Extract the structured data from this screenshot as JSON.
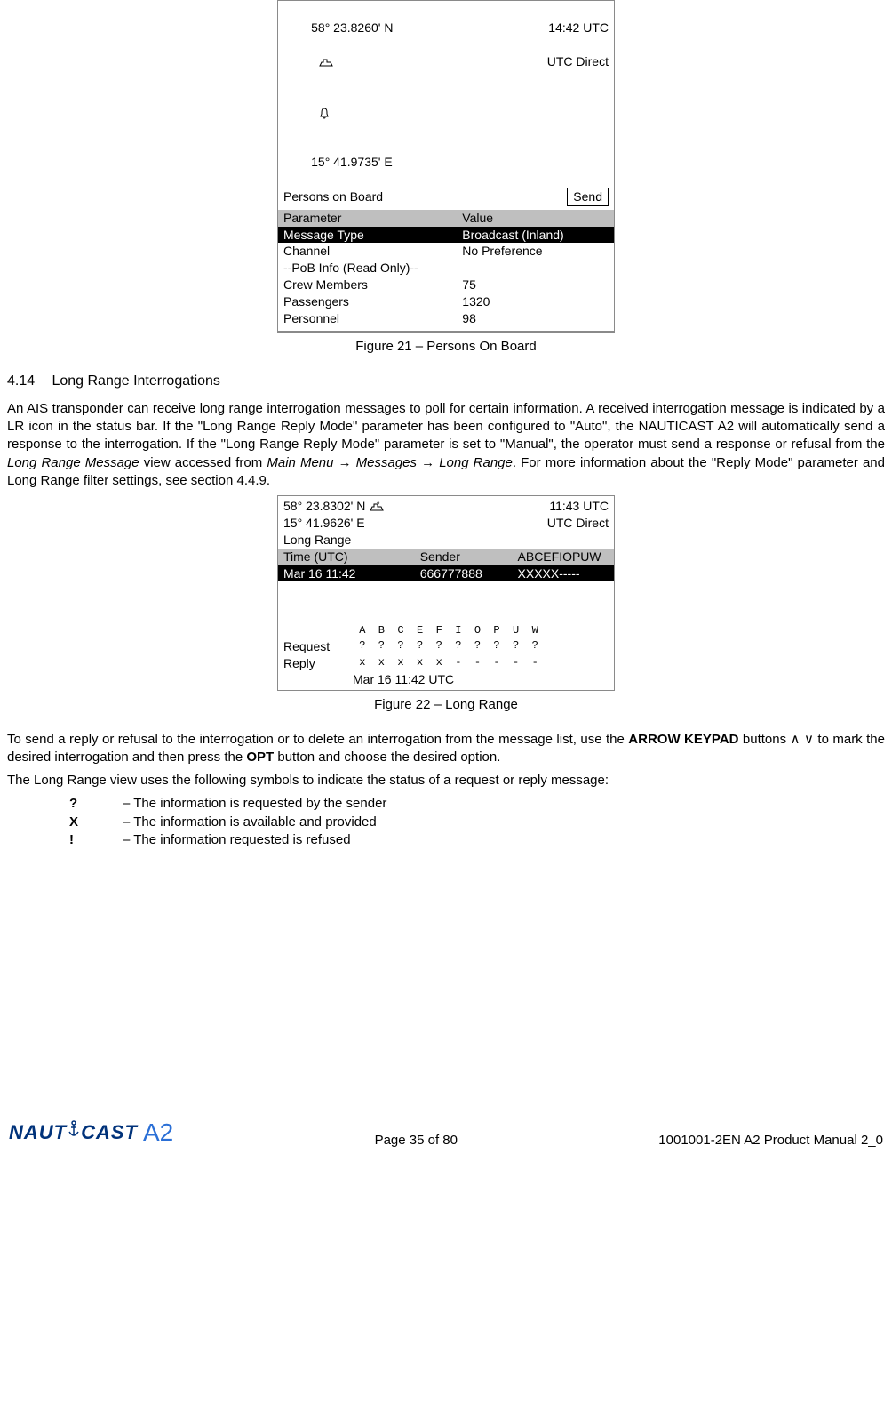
{
  "fig21": {
    "status": {
      "lat": "58° 23.8260' N",
      "lon": "15° 41.9735' E",
      "time": "14:42 UTC",
      "mode": "UTC Direct"
    },
    "title": "Persons on Board",
    "send_btn": "Send",
    "header": {
      "c1": "Parameter",
      "c2": "Value"
    },
    "highlight": {
      "c1": "Message Type",
      "c2": "Broadcast (Inland)"
    },
    "rows": [
      {
        "c1": "Channel",
        "c2": "No Preference"
      },
      {
        "c1": "--PoB Info (Read Only)--",
        "c2": ""
      },
      {
        "c1": "Crew Members",
        "c2": "75"
      },
      {
        "c1": "Passengers",
        "c2": "1320"
      },
      {
        "c1": "Personnel",
        "c2": "98"
      }
    ],
    "caption": "Figure 21 – Persons On Board"
  },
  "section": {
    "num": "4.14",
    "title": "Long Range Interrogations"
  },
  "para1_a": "An AIS transponder can receive long range interrogation messages to poll for certain information. A received interrogation message is indicated by a LR icon in the status bar. If the \"Long Range Reply Mode\" parameter has been configured to \"Auto\", the NAUTICAST A2 will automatically send a response to the interrogation. If the \"Long Range Reply Mode\" parameter is set to \"Manual\", the operator must send a response or refusal from the ",
  "para1_i1": "Long Range Message",
  "para1_b": " view accessed from ",
  "para1_i2": "Main Menu → Messages → Long Range",
  "para1_c": ". For more information about the \"Reply Mode\" parameter and Long Range filter settings, see section 4.4.9.",
  "fig22": {
    "status": {
      "lat": "58° 23.8302' N",
      "lon": "15° 41.9626' E",
      "time": "11:43 UTC",
      "mode": "UTC Direct"
    },
    "title": "Long Range",
    "header": {
      "c1": "Time (UTC)",
      "c2": "Sender",
      "c3": "ABCEFIOPUW"
    },
    "highlight": {
      "c1": "Mar 16 11:42",
      "c2": "666777888",
      "c3": "XXXXX-----"
    },
    "letters": " A  B  C  E  F  I  O  P  U  W",
    "request_lbl": "Request",
    "request_vals": " ?  ?  ?  ?  ?  ?  ?  ?  ?  ?",
    "reply_lbl": "Reply",
    "reply_vals": " x  x  x  x  x  -  -  -  -  -",
    "timestamp": "Mar 16 11:42 UTC",
    "caption": "Figure 22 – Long Range"
  },
  "para2_a": "To send a reply or refusal to the interrogation or to delete an interrogation from the message list, use the ",
  "para2_b": "ARROW KEYPAD",
  "para2_c": " buttons ∧ ∨ to mark the desired interrogation and then press the ",
  "para2_d": "OPT",
  "para2_e": " button and choose the desired option.",
  "para3": "The Long Range view uses the following symbols to indicate the status of a request or reply message:",
  "symbols": [
    {
      "sym": "?",
      "desc": "– The information is requested by the sender"
    },
    {
      "sym": "X",
      "desc": "– The information is available and provided"
    },
    {
      "sym": "!",
      "desc": "– The information requested is refused"
    }
  ],
  "footer": {
    "page": "Page 35 of 80",
    "doc": "1001001-2EN A2 Product Manual 2_0",
    "logo_naut": "NAUT",
    "logo_cast": "CAST",
    "logo_a2": "A2"
  }
}
